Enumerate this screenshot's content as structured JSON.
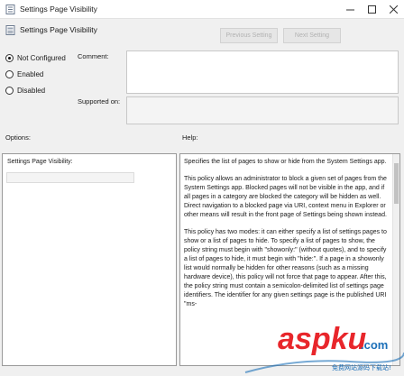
{
  "window": {
    "title": "Settings Page Visibility"
  },
  "header": {
    "title": "Settings Page Visibility",
    "previous_label": "Previous Setting",
    "next_label": "Next Setting"
  },
  "state_options": [
    {
      "label": "Not Configured",
      "checked": true
    },
    {
      "label": "Enabled",
      "checked": false
    },
    {
      "label": "Disabled",
      "checked": false
    }
  ],
  "labels": {
    "comment": "Comment:",
    "supported_on": "Supported on:",
    "options": "Options:",
    "help": "Help:"
  },
  "options_panel": {
    "field_label": "Settings Page Visibility:"
  },
  "help_text": [
    "Specifies the list of pages to show or hide from the System Settings app.",
    "This policy allows an administrator to block a given set of pages from the System Settings app. Blocked pages will not be visible in the app, and if all pages in a category are blocked the category will be hidden as well. Direct navigation to a blocked page via URI, context menu in Explorer or other means will result in the front page of Settings being shown instead.",
    "This policy has two modes: it can either specify a list of settings pages to show or a list of pages to hide. To specify a list of pages to show, the policy string must begin with \"showonly:\" (without quotes), and to specify a list of pages to hide, it must begin with \"hide:\". If a page in a showonly list would normally be hidden for other reasons (such as a missing hardware device), this policy will not force that page to appear. After this, the policy string must contain a semicolon-delimited list of settings page identifiers. The identifier for any given settings page is the published URI \"ms-"
  ],
  "watermark": {
    "brand": "aspku",
    "suffix": ".com",
    "tagline": "免费网站源码下载站!"
  },
  "colors": {
    "watermark_red": "#e8262b",
    "watermark_blue": "#1b6fb8"
  }
}
